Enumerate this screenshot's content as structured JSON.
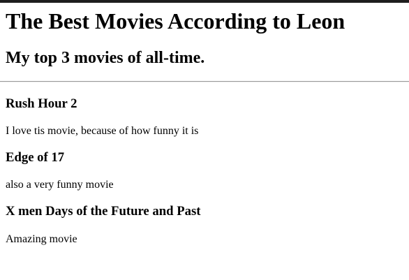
{
  "page": {
    "title": "The Best Movies According to Leon",
    "subtitle": "My top 3 movies of all-time."
  },
  "movies": [
    {
      "title": "Rush Hour 2",
      "description": "I love tis movie, because of how funny it is"
    },
    {
      "title": "Edge of 17",
      "description": "also a very funny movie"
    },
    {
      "title": "X men Days of the Future and Past",
      "description": "Amazing movie"
    }
  ]
}
